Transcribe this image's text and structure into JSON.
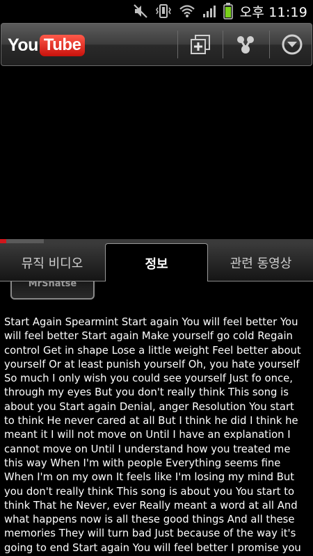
{
  "status_bar": {
    "time": "오후 11:19",
    "icons": [
      "mute-icon",
      "vibrate-icon",
      "wifi-icon",
      "signal-icon",
      "battery-icon"
    ]
  },
  "app_bar": {
    "logo_you": "You",
    "logo_tube": "Tube",
    "buttons": [
      "add-to-playlist-icon",
      "share-icon",
      "menu-dropdown-icon"
    ]
  },
  "player": {
    "progress_fraction": 0.02,
    "buffer_fraction": 0.14
  },
  "tabs": [
    {
      "label": "뮤직 비디오",
      "active": false
    },
    {
      "label": "정보",
      "active": true
    },
    {
      "label": "관련 동영상",
      "active": false
    }
  ],
  "info": {
    "partial_button_label": "MrShatse",
    "description": "Start Again Spearmint Start again You will feel better You will feel better Start again Make yourself go cold Regain control Get in shape Lose a little weight Feel better about yourself Or at least punish yourself Oh, you hate yourself So much I only wish you could see yourself Just fo once, through my eyes But you don't really think This song is about you Start again Denial, anger Resolution You start to think He never cared at all But I think he did I think he meant it I will not move on Until I have an explanation I cannot move on Until I understand how you treated me this way When I'm with people Everything seems fine When I'm on my own It feels like I'm losing my mind But you don't really think This song is about you You start to think That he Never, ever Really meant a word at all And what happens now is all these good things And all these memories They will turn bad Just because of the way it's going to end Start again You will feel better I promise you will feel better And it seems As though all the time was wasted But something must and And nothing is wasted"
  },
  "colors": {
    "accent_red": "#d0161c",
    "background": "#000000"
  }
}
